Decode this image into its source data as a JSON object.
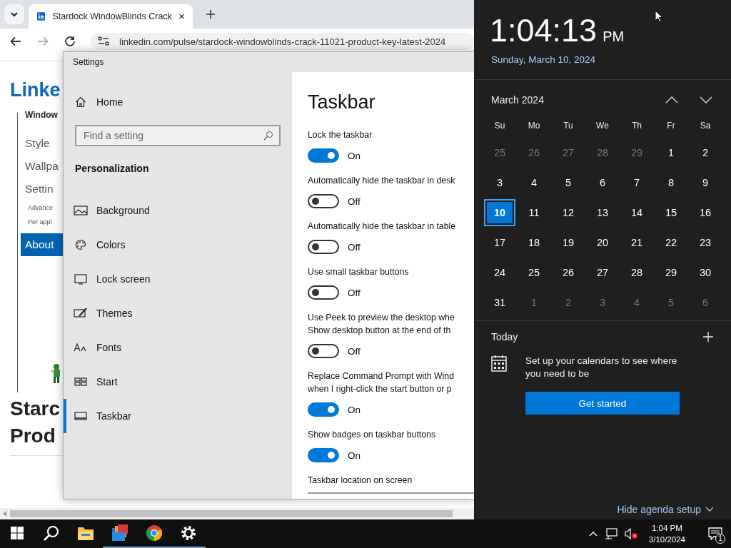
{
  "browser": {
    "tabs": [
      {
        "title": "Stardock WindowBlinds Crack",
        "selected": true
      }
    ],
    "nav": [
      {
        "kind": "back",
        "disabled": false
      },
      {
        "kind": "forward",
        "disabled": true
      },
      {
        "kind": "reload",
        "disabled": false
      }
    ],
    "address": "linkedin.com/pulse/stardock-windowblinds-crack-11021-product-key-latest-2024",
    "page": {
      "logo": "Linke",
      "image_lines": [
        {
          "text": "Window",
          "kind": "heading"
        },
        {
          "text": "Style",
          "kind": "item"
        },
        {
          "text": "Wallpa",
          "kind": "item"
        },
        {
          "text": "Settin",
          "kind": "item"
        },
        {
          "text": "Advance",
          "kind": "sub"
        },
        {
          "text": "Per appl",
          "kind": "sub"
        },
        {
          "text": "About",
          "kind": "selected"
        }
      ],
      "headline": [
        "Starc",
        "Prod"
      ]
    }
  },
  "settings": {
    "title": "Settings",
    "home": "Home",
    "search": {
      "placeholder": "Find a setting"
    },
    "section": "Personalization",
    "nav": [
      {
        "label": "Background",
        "kind": "background",
        "selected": false
      },
      {
        "label": "Colors",
        "kind": "colors",
        "selected": false
      },
      {
        "label": "Lock screen",
        "kind": "lock",
        "selected": false
      },
      {
        "label": "Themes",
        "kind": "themes",
        "selected": false
      },
      {
        "label": "Fonts",
        "kind": "fonts",
        "selected": false
      },
      {
        "label": "Start",
        "kind": "start",
        "selected": false
      },
      {
        "label": "Taskbar",
        "kind": "taskbar",
        "selected": true
      }
    ],
    "heading": "Taskbar",
    "options": [
      {
        "lines": [
          "Lock the taskbar"
        ],
        "on": true,
        "state": "On"
      },
      {
        "lines": [
          "Automatically hide the taskbar in desk"
        ],
        "on": false,
        "state": "Off"
      },
      {
        "lines": [
          "Automatically hide the taskbar in table"
        ],
        "on": false,
        "state": "Off"
      },
      {
        "lines": [
          "Use small taskbar buttons"
        ],
        "on": false,
        "state": "Off"
      },
      {
        "lines": [
          "Use Peek to preview the desktop whe",
          "Show desktop button at the end of th"
        ],
        "on": false,
        "state": "Off"
      },
      {
        "lines": [
          "Replace Command Prompt with Wind",
          "when I right-click the start button or p"
        ],
        "on": true,
        "state": "On"
      },
      {
        "lines": [
          "Show badges on taskbar buttons"
        ],
        "on": true,
        "state": "On"
      }
    ],
    "last_label": "Taskbar location on screen"
  },
  "clock": {
    "time": "1:04:13",
    "ampm": "PM",
    "date": "Sunday, March 10, 2024",
    "month": "March 2024",
    "weekdays": [
      "Su",
      "Mo",
      "Tu",
      "We",
      "Th",
      "Fr",
      "Sa"
    ],
    "days": [
      {
        "day": "25",
        "muted": true,
        "selected": false
      },
      {
        "day": "26",
        "muted": true,
        "selected": false
      },
      {
        "day": "27",
        "muted": true,
        "selected": false
      },
      {
        "day": "28",
        "muted": true,
        "selected": false
      },
      {
        "day": "29",
        "muted": true,
        "selected": false
      },
      {
        "day": "1",
        "muted": false,
        "selected": false
      },
      {
        "day": "2",
        "muted": false,
        "selected": false
      },
      {
        "day": "3",
        "muted": false,
        "selected": false
      },
      {
        "day": "4",
        "muted": false,
        "selected": false
      },
      {
        "day": "5",
        "muted": false,
        "selected": false
      },
      {
        "day": "6",
        "muted": false,
        "selected": false
      },
      {
        "day": "7",
        "muted": false,
        "selected": false
      },
      {
        "day": "8",
        "muted": false,
        "selected": false
      },
      {
        "day": "9",
        "muted": false,
        "selected": false
      },
      {
        "day": "10",
        "muted": false,
        "selected": true
      },
      {
        "day": "11",
        "muted": false,
        "selected": false
      },
      {
        "day": "12",
        "muted": false,
        "selected": false
      },
      {
        "day": "13",
        "muted": false,
        "selected": false
      },
      {
        "day": "14",
        "muted": false,
        "selected": false
      },
      {
        "day": "15",
        "muted": false,
        "selected": false
      },
      {
        "day": "16",
        "muted": false,
        "selected": false
      },
      {
        "day": "17",
        "muted": false,
        "selected": false
      },
      {
        "day": "18",
        "muted": false,
        "selected": false
      },
      {
        "day": "19",
        "muted": false,
        "selected": false
      },
      {
        "day": "20",
        "muted": false,
        "selected": false
      },
      {
        "day": "21",
        "muted": false,
        "selected": false
      },
      {
        "day": "22",
        "muted": false,
        "selected": false
      },
      {
        "day": "23",
        "muted": false,
        "selected": false
      },
      {
        "day": "24",
        "muted": false,
        "selected": false
      },
      {
        "day": "25",
        "muted": false,
        "selected": false
      },
      {
        "day": "26",
        "muted": false,
        "selected": false
      },
      {
        "day": "27",
        "muted": false,
        "selected": false
      },
      {
        "day": "28",
        "muted": false,
        "selected": false
      },
      {
        "day": "29",
        "muted": false,
        "selected": false
      },
      {
        "day": "30",
        "muted": false,
        "selected": false
      },
      {
        "day": "31",
        "muted": false,
        "selected": false
      },
      {
        "day": "1",
        "muted": true,
        "selected": false
      },
      {
        "day": "2",
        "muted": true,
        "selected": false
      },
      {
        "day": "3",
        "muted": true,
        "selected": false
      },
      {
        "day": "4",
        "muted": true,
        "selected": false
      },
      {
        "day": "5",
        "muted": true,
        "selected": false
      },
      {
        "day": "6",
        "muted": true,
        "selected": false
      }
    ],
    "agenda_title": "Today",
    "agenda_text": "Set up your calendars to see where you need to be",
    "agenda_button": "Get started",
    "hide_link": "Hide agenda setup"
  },
  "taskbar": {
    "apps": [
      {
        "kind": "start",
        "running": false
      },
      {
        "kind": "search",
        "running": false
      },
      {
        "kind": "explorer",
        "running": false
      },
      {
        "kind": "books",
        "running": true
      },
      {
        "kind": "chrome",
        "running": true
      },
      {
        "kind": "gear",
        "running": true
      }
    ],
    "time": "1:04 PM",
    "date": "3/10/2024",
    "notifications": "1"
  }
}
